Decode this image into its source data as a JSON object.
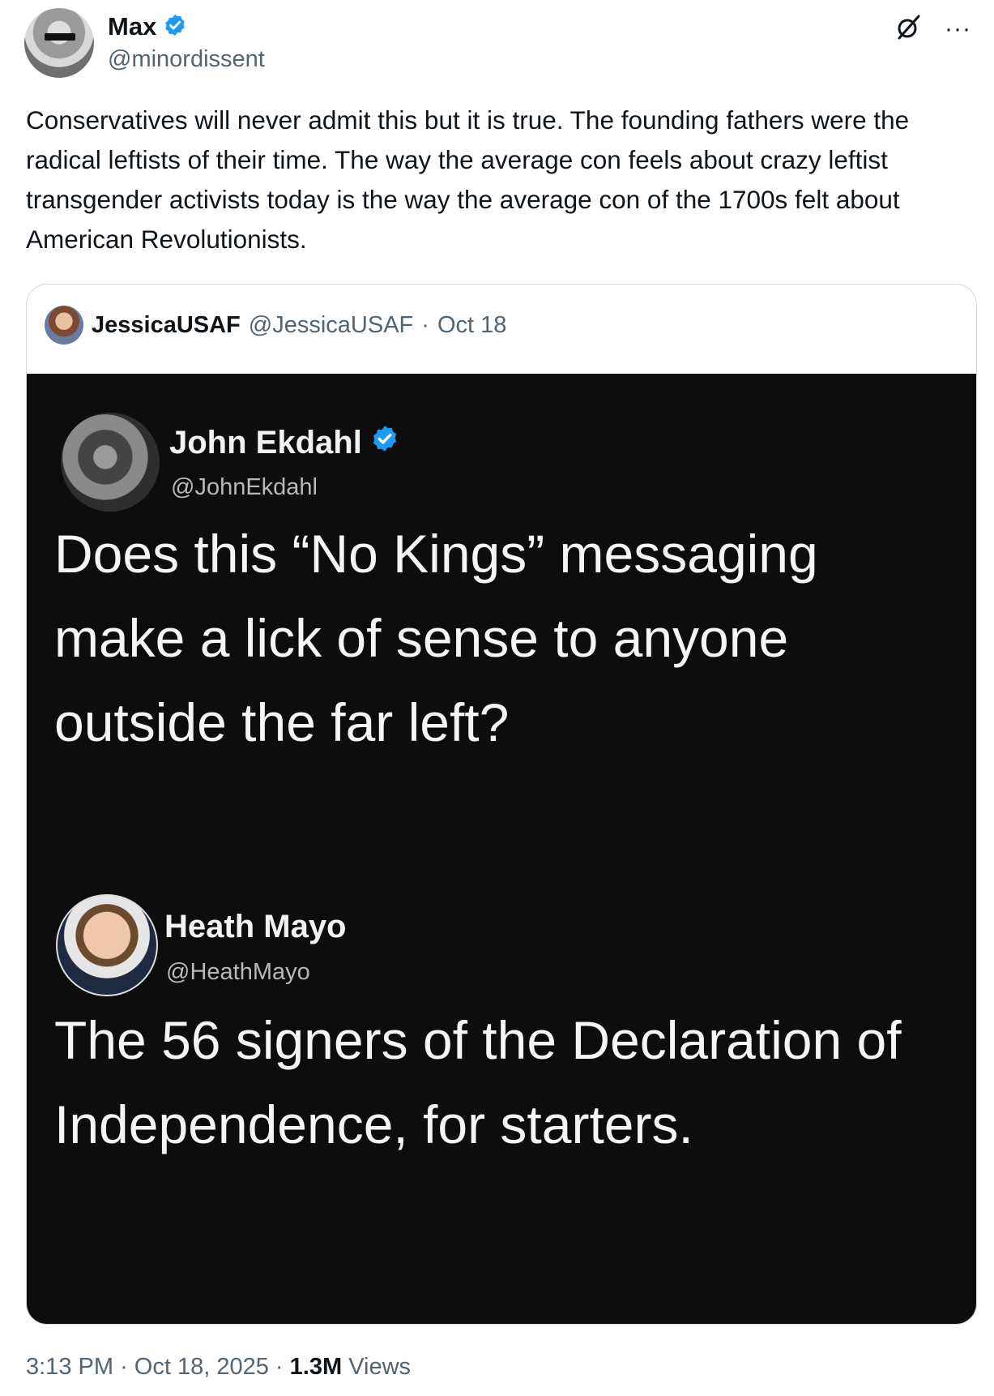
{
  "author": {
    "display_name": "Max",
    "handle": "@minordissent",
    "verified_badge_icon": "verified-badge-icon",
    "accent_color": "#1d9bf0"
  },
  "header_icons": {
    "grok": "grok-icon",
    "more": "more-icon",
    "more_glyph": "···"
  },
  "tweet_text": "Conservatives will never admit this but it is true. The founding fathers were the radical leftists of their time. The way the average con feels about crazy leftist transgender activists today is the way the average con of the 1700s felt about American Revolutionists.",
  "quoted_tweet": {
    "display_name": "JessicaUSAF",
    "handle": "@JessicaUSAF",
    "separator": "·",
    "date": "Oct 18",
    "image": {
      "first": {
        "display_name": "John Ekdahl",
        "handle": "@JohnEkdahl",
        "text": "Does this “No Kings” messaging make a lick of sense to anyone outside the far left?"
      },
      "second": {
        "display_name": "Heath Mayo",
        "handle": "@HeathMayo",
        "text": "The 56 signers of the Declaration of Independence, for starters."
      }
    }
  },
  "footer": {
    "time": "3:13 PM",
    "separator": "·",
    "date": "Oct 18, 2025",
    "views_count": "1.3M",
    "views_label": "Views"
  }
}
